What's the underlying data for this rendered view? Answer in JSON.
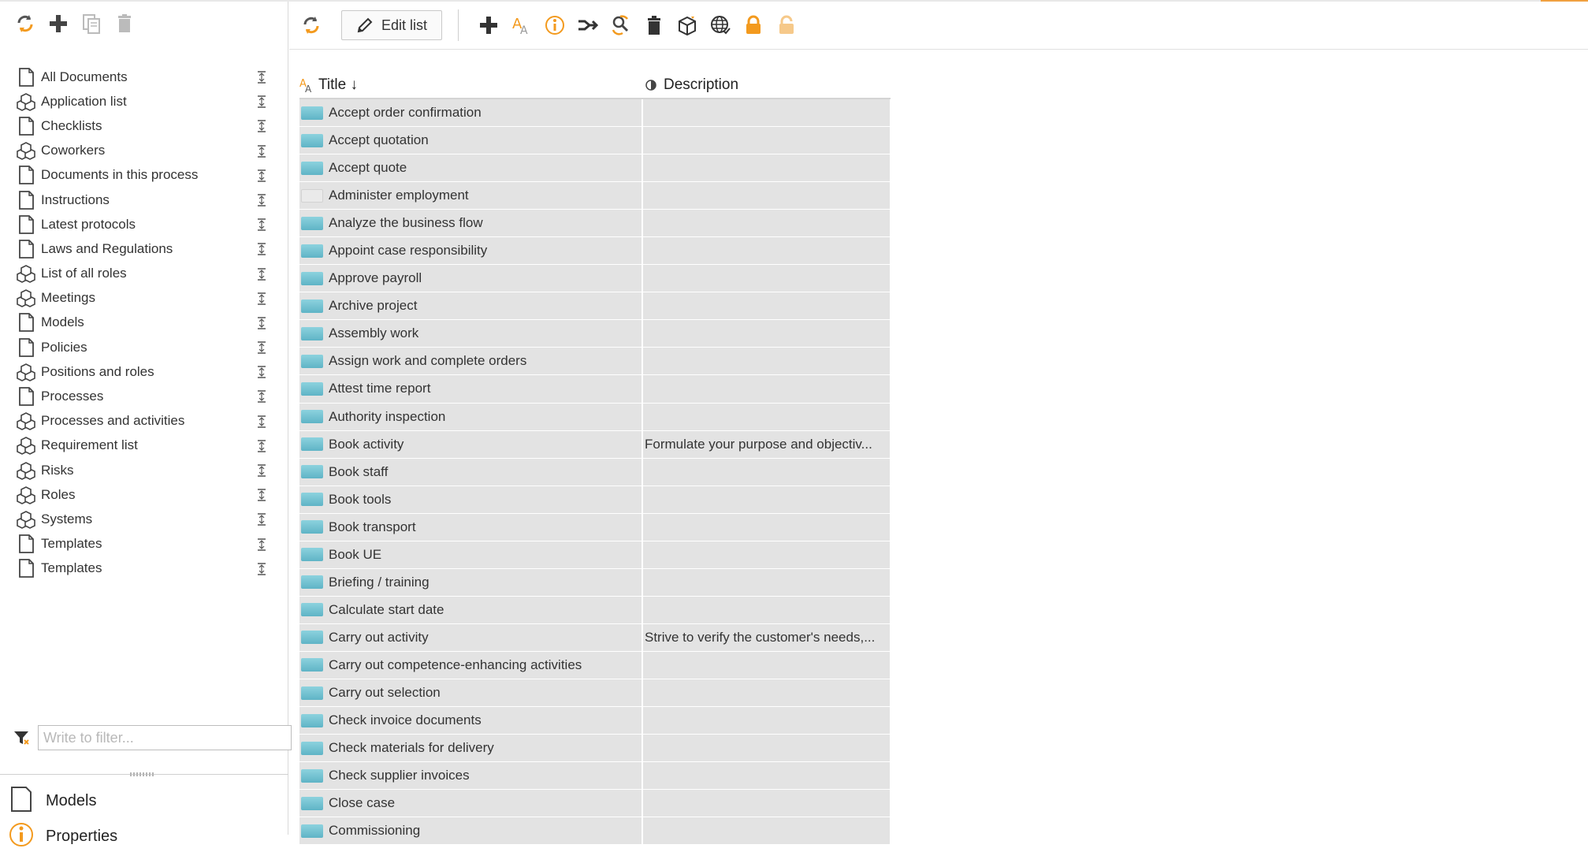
{
  "left_toolbar": {
    "icons": [
      "refresh-icon",
      "add-icon",
      "copy-icon",
      "trash-icon"
    ]
  },
  "nav": {
    "items": [
      {
        "label": "All Documents",
        "icon": "document-icon"
      },
      {
        "label": "Application list",
        "icon": "cubes-icon"
      },
      {
        "label": "Checklists",
        "icon": "document-icon"
      },
      {
        "label": "Coworkers",
        "icon": "cubes-icon"
      },
      {
        "label": "Documents in this process",
        "icon": "document-icon"
      },
      {
        "label": "Instructions",
        "icon": "document-icon"
      },
      {
        "label": "Latest protocols",
        "icon": "document-icon"
      },
      {
        "label": "Laws and Regulations",
        "icon": "document-icon"
      },
      {
        "label": "List of all roles",
        "icon": "cubes-icon"
      },
      {
        "label": "Meetings",
        "icon": "cubes-icon"
      },
      {
        "label": "Models",
        "icon": "document-icon"
      },
      {
        "label": "Policies",
        "icon": "document-icon"
      },
      {
        "label": "Positions and roles",
        "icon": "cubes-icon"
      },
      {
        "label": "Processes",
        "icon": "document-icon"
      },
      {
        "label": "Processes and activities",
        "icon": "cubes-icon"
      },
      {
        "label": "Requirement list",
        "icon": "cubes-icon"
      },
      {
        "label": "Risks",
        "icon": "cubes-icon"
      },
      {
        "label": "Roles",
        "icon": "cubes-icon"
      },
      {
        "label": "Systems",
        "icon": "cubes-icon"
      },
      {
        "label": "Templates",
        "icon": "document-icon"
      },
      {
        "label": "Templates",
        "icon": "document-icon"
      }
    ]
  },
  "filter": {
    "placeholder": "Write to filter..."
  },
  "bottom_tabs": {
    "models": "Models",
    "properties": "Properties"
  },
  "main_toolbar": {
    "edit_label": "Edit list",
    "icons": [
      "add-icon",
      "font-size-icon",
      "info-icon",
      "merge-icon",
      "replace-icon",
      "trash-icon",
      "package-icon",
      "globe-icon",
      "lock-icon",
      "unlock-icon"
    ]
  },
  "grid": {
    "columns": {
      "title": "Title ↓",
      "description": "Description"
    },
    "rows": [
      {
        "title": "Accept order confirmation",
        "description": "",
        "folder": "blue"
      },
      {
        "title": "Accept quotation",
        "description": "",
        "folder": "blue"
      },
      {
        "title": "Accept quote",
        "description": "",
        "folder": "blue"
      },
      {
        "title": "Administer employment",
        "description": "",
        "folder": "empty"
      },
      {
        "title": "Analyze the business flow",
        "description": "",
        "folder": "blue"
      },
      {
        "title": "Appoint case responsibility",
        "description": "",
        "folder": "blue"
      },
      {
        "title": "Approve payroll",
        "description": "",
        "folder": "blue"
      },
      {
        "title": "Archive project",
        "description": "",
        "folder": "blue"
      },
      {
        "title": "Assembly work",
        "description": "",
        "folder": "blue"
      },
      {
        "title": "Assign work and complete orders",
        "description": "",
        "folder": "blue"
      },
      {
        "title": "Attest time report",
        "description": "",
        "folder": "blue"
      },
      {
        "title": "Authority inspection",
        "description": "",
        "folder": "blue"
      },
      {
        "title": "Book activity",
        "description": "Formulate your purpose and objectiv...",
        "folder": "blue"
      },
      {
        "title": "Book staff",
        "description": "",
        "folder": "blue"
      },
      {
        "title": "Book tools",
        "description": "",
        "folder": "blue"
      },
      {
        "title": "Book transport",
        "description": "",
        "folder": "blue"
      },
      {
        "title": "Book UE",
        "description": "",
        "folder": "blue"
      },
      {
        "title": "Briefing / training",
        "description": "",
        "folder": "blue"
      },
      {
        "title": "Calculate start date",
        "description": "",
        "folder": "blue"
      },
      {
        "title": "Carry out activity",
        "description": "Strive to verify the customer's needs,...",
        "folder": "blue"
      },
      {
        "title": "Carry out competence-enhancing activities",
        "description": "",
        "folder": "blue"
      },
      {
        "title": "Carry out selection",
        "description": "",
        "folder": "blue"
      },
      {
        "title": "Check invoice documents",
        "description": "",
        "folder": "blue"
      },
      {
        "title": "Check materials for delivery",
        "description": "",
        "folder": "blue"
      },
      {
        "title": "Check supplier invoices",
        "description": "",
        "folder": "blue"
      },
      {
        "title": "Close case",
        "description": "",
        "folder": "blue"
      },
      {
        "title": "Commissioning",
        "description": "",
        "folder": "blue"
      }
    ]
  },
  "colors": {
    "accent_orange": "#f39a1e",
    "folder_blue": "#6cc0d0",
    "row_gray": "#e3e3e3"
  }
}
